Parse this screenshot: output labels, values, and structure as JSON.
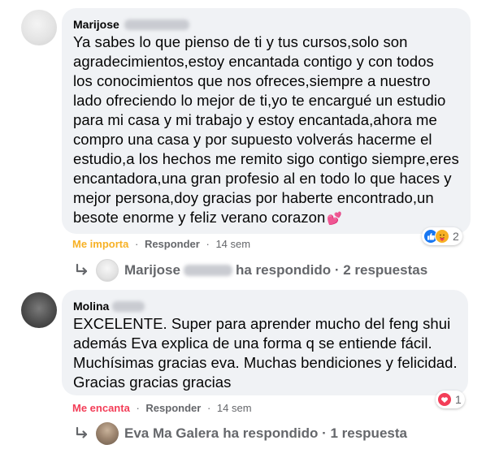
{
  "comments": [
    {
      "author": "Marijose",
      "text": "Ya sabes lo que pienso de ti y tus cursos,solo son\nagradecimientos,estoy encantada contigo y con todos\nlos conocimientos que nos ofreces,siempre a nuestro\nlado ofreciendo lo mejor de ti,yo te encargué un estudio\npara mi casa y mi trabajo y estoy encantada,ahora me\ncompro una casa y por supuesto volverás hacerme el\nestudio,a los hechos me remito sigo contigo siempre,eres\nencantadora,una gran profesio al en todo lo que haces y\nmejor persona,doy gracias por haberte encontrado,un\nbesote enorme y feliz verano corazon",
      "reaction_action": "Me importa",
      "reply_action": "Responder",
      "time": "14 sem",
      "reaction_count": "2",
      "reaction_icons": [
        "like-icon",
        "care-icon"
      ],
      "replies_author": "Marijose",
      "replies_text": "ha respondido · 2 respuestas"
    },
    {
      "author": "Molina",
      "text": "EXCELENTE. Super para aprender mucho del feng shui\nademás Eva explica de una forma q se entiende fácil.\nMuchísimas gracias eva. Muchas bendiciones y felicidad.\nGracias gracias gracias",
      "reaction_action": "Me encanta",
      "reply_action": "Responder",
      "time": "14 sem",
      "reaction_count": "1",
      "reaction_icons": [
        "love-icon"
      ],
      "replies_author": "Eva Ma Galera",
      "replies_text": "ha respondido · 1 respuesta"
    }
  ],
  "separator": "·",
  "colors": {
    "bubble_bg": "#f0f2f5",
    "meta_gray": "#65676b",
    "love_red": "#f33e58",
    "care_yellow": "#f7b125",
    "like_blue": "#1877f2"
  }
}
